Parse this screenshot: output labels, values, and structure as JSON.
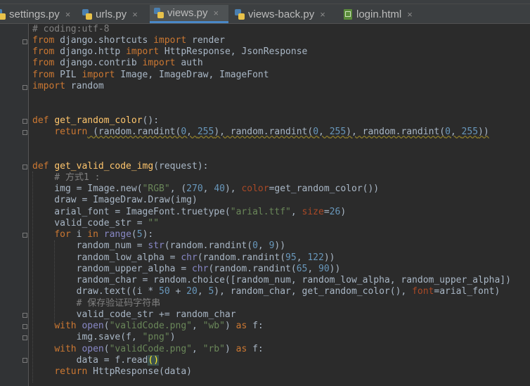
{
  "editor": {
    "tabs": [
      {
        "label": "settings.py",
        "icon": "python-file-icon",
        "active": false
      },
      {
        "label": "urls.py",
        "icon": "python-file-icon",
        "active": false
      },
      {
        "label": "views.py",
        "icon": "python-file-icon",
        "active": true
      },
      {
        "label": "views-back.py",
        "icon": "python-file-icon",
        "active": false
      },
      {
        "label": "login.html",
        "icon": "html-file-icon",
        "active": false
      }
    ],
    "close_glyph": "×",
    "code": {
      "l1": "# coding:utf-8",
      "l2": [
        "from",
        " django.shortcuts ",
        "import",
        " render"
      ],
      "l3": [
        "from",
        " django.http ",
        "import",
        " HttpResponse, JsonResponse"
      ],
      "l4": [
        "from",
        " django.contrib ",
        "import",
        " auth"
      ],
      "l5": [
        "from",
        " PIL ",
        "import",
        " Image, ImageDraw, ImageFont"
      ],
      "l6": [
        "import",
        " random"
      ],
      "l7": [
        "def",
        " ",
        "get_random_color",
        "():"
      ],
      "l8": [
        "    ",
        "return",
        " (random.randint(",
        "0",
        ", ",
        "255",
        "), random.randint(",
        "0",
        ", ",
        "255",
        "), random.randint(",
        "0",
        ", ",
        "255",
        "))"
      ],
      "l9": [
        "def",
        " ",
        "get_valid_code_img",
        "(request):"
      ],
      "l10": "    # 方式1 :",
      "l11": [
        "    img = Image.new(",
        "\"RGB\"",
        ", (",
        "270",
        ", ",
        "40",
        "), ",
        "color",
        "=get_random_color())"
      ],
      "l12": "    draw = ImageDraw.Draw(img)",
      "l13": [
        "    arial_font = ImageFont.truetype(",
        "\"arial.ttf\"",
        ", ",
        "size",
        "=",
        "26",
        ")"
      ],
      "l14": [
        "    valid_code_str = ",
        "\"\""
      ],
      "l15": [
        "    ",
        "for",
        " i ",
        "in",
        " ",
        "range",
        "(",
        "5",
        "):"
      ],
      "l16": [
        "        random_num = ",
        "str",
        "(random.randint(",
        "0",
        ", ",
        "9",
        "))"
      ],
      "l17": [
        "        random_low_alpha = ",
        "chr",
        "(random.randint(",
        "95",
        ", ",
        "122",
        "))"
      ],
      "l18": [
        "        random_upper_alpha = ",
        "chr",
        "(random.randint(",
        "65",
        ", ",
        "90",
        "))"
      ],
      "l19": "        random_char = random.choice([random_num, random_low_alpha, random_upper_alpha])",
      "l20": [
        "        draw.text((i * ",
        "50",
        " + ",
        "20",
        ", ",
        "5",
        "), random_char, get_random_color(), ",
        "font",
        "=arial_font)"
      ],
      "l21": "        # 保存验证码字符串",
      "l22": "        valid_code_str += random_char",
      "l23": [
        "    ",
        "with",
        " ",
        "open",
        "(",
        "\"validCode.png\"",
        ", ",
        "\"wb\"",
        ") ",
        "as",
        " f:"
      ],
      "l24": [
        "        img.save(f, ",
        "\"png\"",
        ")"
      ],
      "l25": [
        "    ",
        "with",
        " ",
        "open",
        "(",
        "\"validCode.png\"",
        ", ",
        "\"rb\"",
        ") ",
        "as",
        " f:"
      ],
      "l26": [
        "        data = f.read",
        "(",
        ")"
      ],
      "l27": [
        "    ",
        "return",
        " HttpResponse(data)"
      ]
    }
  }
}
